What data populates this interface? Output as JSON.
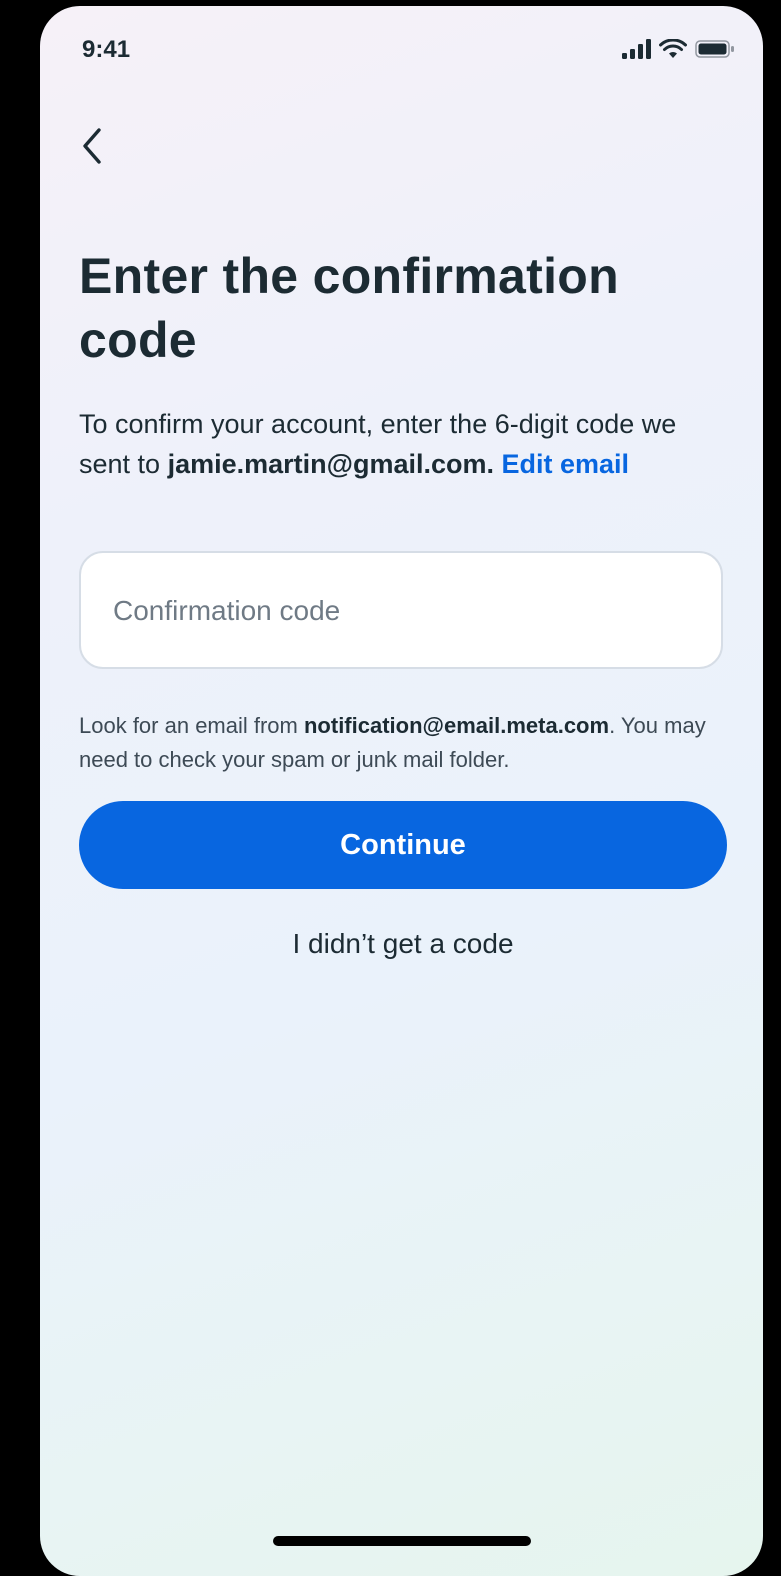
{
  "status_bar": {
    "time": "9:41",
    "icons": [
      "signal-icon",
      "wifi-icon",
      "battery-icon"
    ]
  },
  "nav": {
    "back_icon": "chevron-left-icon"
  },
  "page": {
    "title": "Enter the confirmation code",
    "description_prefix": "To confirm your account, enter the 6-digit code we sent to ",
    "email": "jamie.martin@gmail.com.",
    "edit_email_label": "Edit email",
    "code_input": {
      "placeholder": "Confirmation code",
      "value": ""
    },
    "hint_prefix": "Look for an email from ",
    "sender_email": "notification@email.meta.com",
    "hint_suffix": ". You may need to check your spam or junk mail folder.",
    "continue_label": "Continue",
    "no_code_label": "I didn’t get a code"
  },
  "colors": {
    "primary": "#0866e0",
    "text": "#1c2b33",
    "background": "#eef1fa"
  }
}
